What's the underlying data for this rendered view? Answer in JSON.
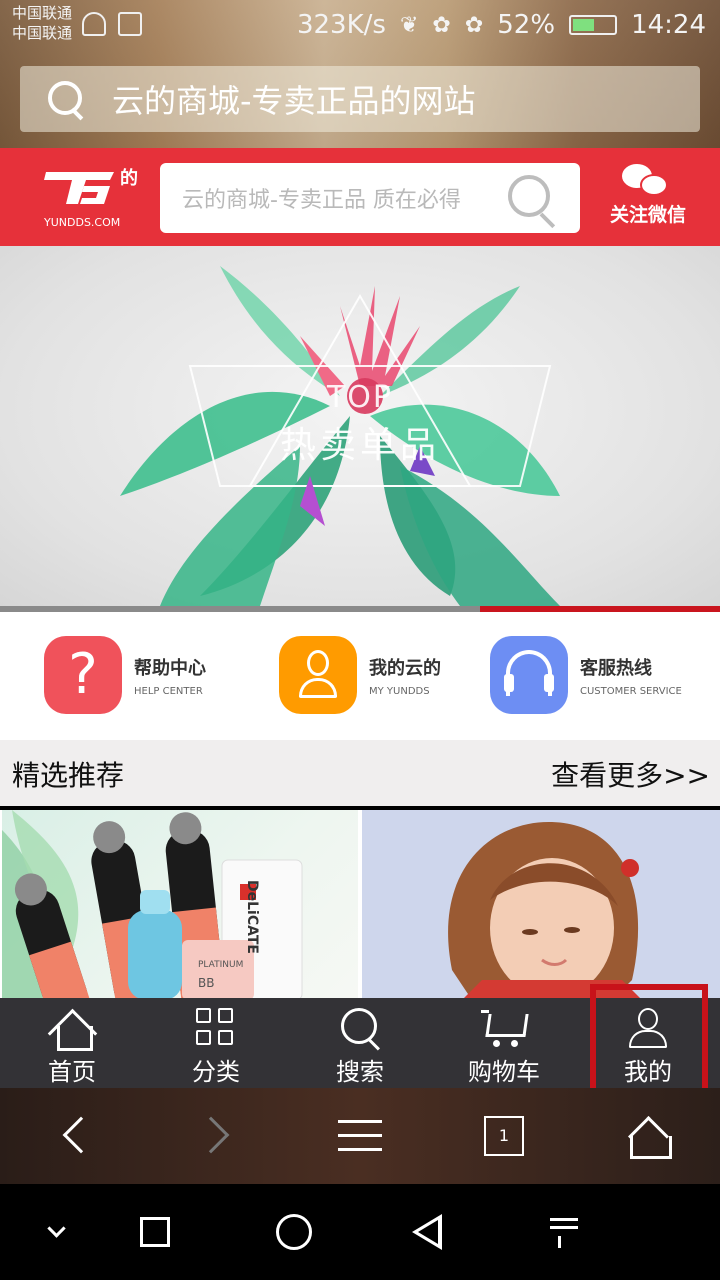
{
  "status_bar": {
    "carrier1": "中国联通",
    "carrier2": "中国联通",
    "speed": "323K/s",
    "battery": "52%",
    "battery_level": 0.52,
    "time": "14:24"
  },
  "browser": {
    "address": "云的商城-专卖正品的网站",
    "tab_count": "1"
  },
  "site": {
    "logo_char": "的",
    "logo_domain": "YUNDDS.COM",
    "search_placeholder": "云的商城-专卖正品  质在必得",
    "wechat_label": "关注微信"
  },
  "banner": {
    "top": "TOP",
    "title": "热卖单品"
  },
  "quick_links": [
    {
      "cn": "帮助中心",
      "en": "HELP CENTER"
    },
    {
      "cn": "我的云的",
      "en": "MY YUNDDS"
    },
    {
      "cn": "客服热线",
      "en": "CUSTOMER SERVICE"
    }
  ],
  "section": {
    "title": "精选推荐",
    "more": "查看更多>>"
  },
  "product_texts": {
    "p1_a": "DeLiCATE",
    "p1_b": "PLATINUM",
    "p1_c": "BB"
  },
  "app_nav": [
    {
      "label": "首页",
      "icon": "home-icon"
    },
    {
      "label": "分类",
      "icon": "grid-icon"
    },
    {
      "label": "搜索",
      "icon": "search-icon"
    },
    {
      "label": "购物车",
      "icon": "cart-icon"
    },
    {
      "label": "我的",
      "icon": "user-icon"
    }
  ],
  "colors": {
    "brand_red": "#e6313a",
    "highlight": "#c8121a",
    "help": "#f0525b",
    "my": "#ff9b00",
    "service": "#6d8ef3"
  }
}
